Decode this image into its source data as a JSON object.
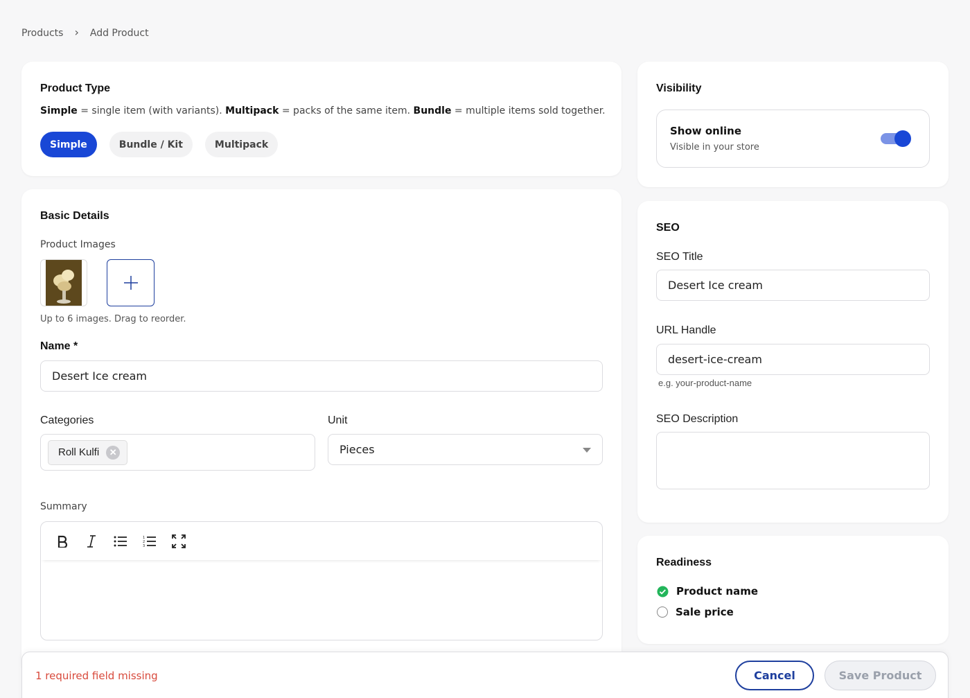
{
  "breadcrumb": {
    "parent": "Products",
    "current": "Add Product"
  },
  "product_type": {
    "title": "Product Type",
    "desc_simple_term": "Simple",
    "desc_simple_text": " = single item (with variants). ",
    "desc_multipack_term": "Multipack",
    "desc_multipack_text": " = packs of the same item. ",
    "desc_bundle_term": "Bundle",
    "desc_bundle_text": " = multiple items sold together.",
    "options": [
      "Simple",
      "Bundle / Kit",
      "Multipack"
    ],
    "selected": "Simple"
  },
  "basic": {
    "title": "Basic Details",
    "images_label": "Product Images",
    "images_hint": "Up to 6 images. Drag to reorder.",
    "name_label": "Name *",
    "name_value": "Desert Ice cream",
    "categories_label": "Categories",
    "category_chip": "Roll Kulfi",
    "unit_label": "Unit",
    "unit_value": "Pieces",
    "summary_label": "Summary"
  },
  "visibility": {
    "title": "Visibility",
    "option_title": "Show online",
    "option_sub": "Visible in your store",
    "enabled": true
  },
  "seo": {
    "title": "SEO",
    "seo_title_label": "SEO Title",
    "seo_title_value": "Desert Ice cream",
    "url_label": "URL Handle",
    "url_value": "desert-ice-cream",
    "url_hint": "e.g. your-product-name",
    "desc_label": "SEO Description",
    "desc_value": ""
  },
  "readiness": {
    "title": "Readiness",
    "items": [
      {
        "label": "Product name",
        "done": true
      },
      {
        "label": "Sale price",
        "done": false
      }
    ]
  },
  "footer": {
    "missing": "1 required field missing",
    "cancel": "Cancel",
    "save": "Save Product"
  },
  "colors": {
    "accent": "#1947d6",
    "accent_dark": "#1e3f9e",
    "success": "#22b55a",
    "error": "#d84a3c"
  }
}
